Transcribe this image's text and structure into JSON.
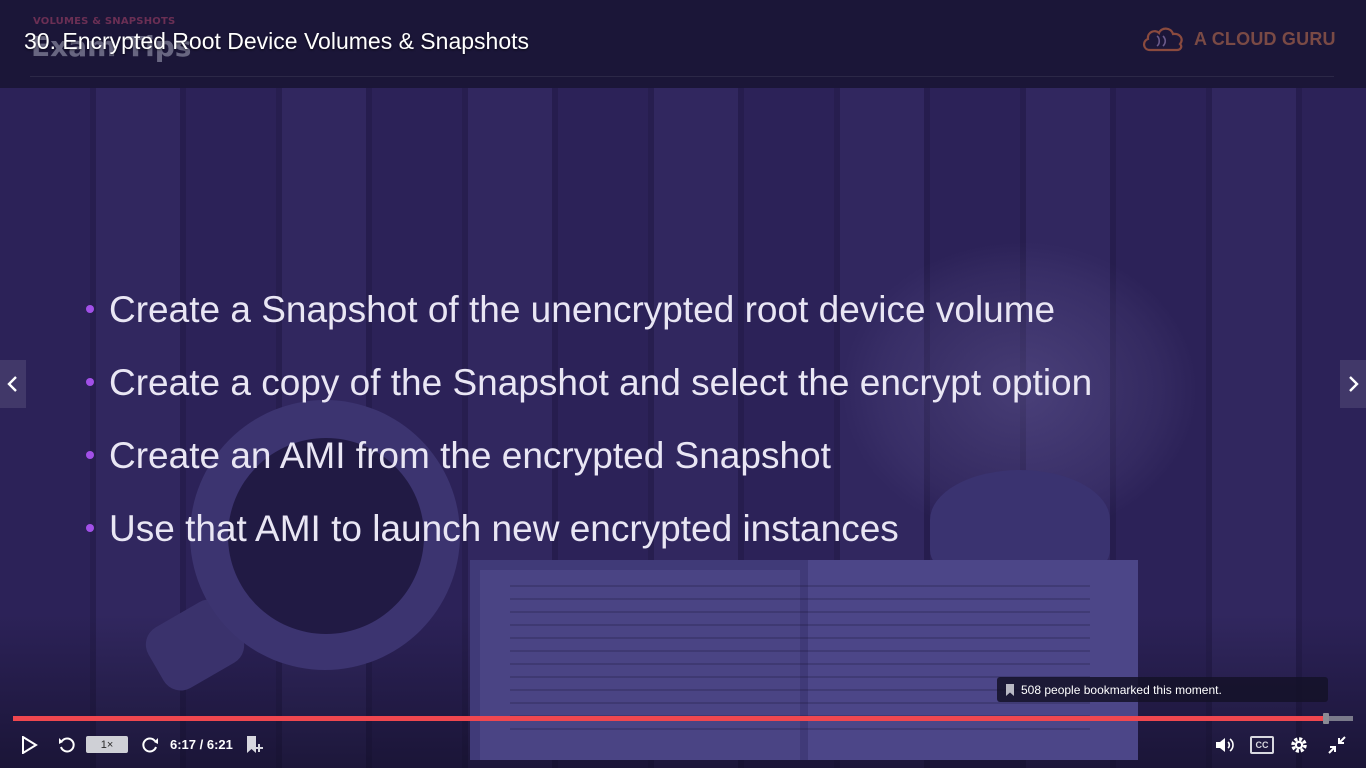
{
  "header": {
    "section_tag": "VOLUMES & SNAPSHOTS",
    "section_title": "Exam Tips",
    "lesson_title": "30. Encrypted Root Device Volumes & Snapshots",
    "brand": "A CLOUD GURU"
  },
  "slide": {
    "bullets": [
      "Create a Snapshot of the unencrypted root device volume",
      "Create a copy of the Snapshot and select the encrypt option",
      "Create an AMI from the encrypted Snapshot",
      "Use that AMI to launch new encrypted instances"
    ],
    "bullet_color": "#a250e8"
  },
  "tooltip": {
    "text": "508 people bookmarked this moment."
  },
  "player": {
    "progress_fraction": 0.98,
    "speed_label": "1×",
    "time_label": "6:17 / 6:21",
    "progress_color": "#f0474f",
    "cc_label": "CC"
  }
}
